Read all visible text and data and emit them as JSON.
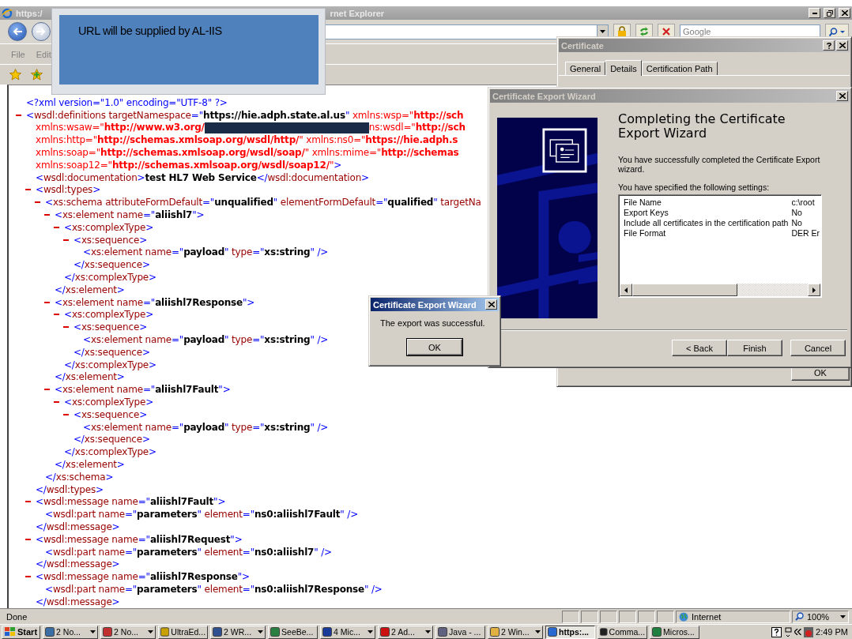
{
  "browser": {
    "title_left": "https:/",
    "title_right": "rnet Explorer",
    "search_placeholder": "Google",
    "menu": [
      "File",
      "Edit"
    ],
    "status": "Done",
    "zone": "Internet",
    "zoom": "100%"
  },
  "xml": [
    {
      "line": [
        {
          "kind": "punct",
          "text": "<?xml version=\"1.0\" encoding=\"UTF-8\" ?>"
        }
      ]
    },
    {
      "expanded": true,
      "open": [
        [
          {
            "kind": "punct",
            "text": "<"
          },
          {
            "kind": "name",
            "text": "wsdl:definitions targetNamespace"
          },
          {
            "kind": "punct",
            "text": "=\""
          },
          {
            "kind": "value",
            "text": "https://hie.adph.state.al.us"
          },
          {
            "kind": "punct",
            "text": "\""
          },
          {
            "kind": "ns_name",
            "text": " xmlns:wsp=\""
          },
          {
            "kind": "ns_value",
            "text": "http://sch"
          }
        ],
        [
          {
            "kind": "ns_name",
            "text": "xmlns:wsaw=\""
          },
          {
            "kind": "ns_value",
            "text": "http://www.w3.org/"
          },
          {
            "kind": "redaction"
          },
          {
            "kind": "ns_name",
            "text": "ns:wsdl=\""
          },
          {
            "kind": "ns_value",
            "text": "http://sch"
          }
        ],
        [
          {
            "kind": "ns_name",
            "text": "xmlns:http=\""
          },
          {
            "kind": "ns_value",
            "text": "http://schemas.xmlsoap.org/wsdl/http/"
          },
          {
            "kind": "ns_name",
            "text": "\" xmlns:ns0=\""
          },
          {
            "kind": "ns_value",
            "text": "https://hie.adph.s"
          }
        ],
        [
          {
            "kind": "ns_name",
            "text": "xmlns:soap=\""
          },
          {
            "kind": "ns_value",
            "text": "http://schemas.xmlsoap.org/wsdl/soap/"
          },
          {
            "kind": "ns_name",
            "text": "\" xmlns:mime=\""
          },
          {
            "kind": "ns_value",
            "text": "http://schemas"
          }
        ],
        [
          {
            "kind": "ns_name",
            "text": "xmlns:soap12=\""
          },
          {
            "kind": "ns_value",
            "text": "http://schemas.xmlsoap.org/wsdl/soap12/"
          },
          {
            "kind": "ns_name",
            "text": "\""
          },
          {
            "kind": "punct",
            "text": ">"
          }
        ]
      ],
      "children": [
        {
          "line": [
            {
              "kind": "punct",
              "text": "<"
            },
            {
              "kind": "name",
              "text": "wsdl:documentation"
            },
            {
              "kind": "punct",
              "text": ">"
            },
            {
              "kind": "text",
              "text": "test HL7 Web Service"
            },
            {
              "kind": "punct",
              "text": "</"
            },
            {
              "kind": "name",
              "text": "wsdl:documentation"
            },
            {
              "kind": "punct",
              "text": ">"
            }
          ]
        },
        {
          "expanded": true,
          "open": [
            [
              {
                "kind": "punct",
                "text": "<"
              },
              {
                "kind": "name",
                "text": "wsdl:types"
              },
              {
                "kind": "punct",
                "text": ">"
              }
            ]
          ],
          "children": [
            {
              "expanded": true,
              "open": [
                [
                  {
                    "kind": "punct",
                    "text": "<"
                  },
                  {
                    "kind": "name",
                    "text": "xs:schema attributeFormDefault"
                  },
                  {
                    "kind": "punct",
                    "text": "=\""
                  },
                  {
                    "kind": "value",
                    "text": "unqualified"
                  },
                  {
                    "kind": "punct",
                    "text": "\""
                  },
                  {
                    "kind": "name",
                    "text": " elementFormDefault"
                  },
                  {
                    "kind": "punct",
                    "text": "=\""
                  },
                  {
                    "kind": "value",
                    "text": "qualified"
                  },
                  {
                    "kind": "punct",
                    "text": "\""
                  },
                  {
                    "kind": "name",
                    "text": " targetNa"
                  }
                ]
              ],
              "children": [
                {
                  "expanded": true,
                  "open": [
                    [
                      {
                        "kind": "punct",
                        "text": "<"
                      },
                      {
                        "kind": "name",
                        "text": "xs:element name"
                      },
                      {
                        "kind": "punct",
                        "text": "=\""
                      },
                      {
                        "kind": "value",
                        "text": "aliishl7"
                      },
                      {
                        "kind": "punct",
                        "text": "\">"
                      }
                    ]
                  ],
                  "children": [
                    {
                      "expanded": true,
                      "open": [
                        [
                          {
                            "kind": "punct",
                            "text": "<"
                          },
                          {
                            "kind": "name",
                            "text": "xs:complexType"
                          },
                          {
                            "kind": "punct",
                            "text": ">"
                          }
                        ]
                      ],
                      "children": [
                        {
                          "expanded": true,
                          "open": [
                            [
                              {
                                "kind": "punct",
                                "text": "<"
                              },
                              {
                                "kind": "name",
                                "text": "xs:sequence"
                              },
                              {
                                "kind": "punct",
                                "text": ">"
                              }
                            ]
                          ],
                          "children": [
                            {
                              "line": [
                                {
                                  "kind": "punct",
                                  "text": "<"
                                },
                                {
                                  "kind": "name",
                                  "text": "xs:element name"
                                },
                                {
                                  "kind": "punct",
                                  "text": "=\""
                                },
                                {
                                  "kind": "value",
                                  "text": "payload"
                                },
                                {
                                  "kind": "punct",
                                  "text": "\""
                                },
                                {
                                  "kind": "name",
                                  "text": " type"
                                },
                                {
                                  "kind": "punct",
                                  "text": "=\""
                                },
                                {
                                  "kind": "value",
                                  "text": "xs:string"
                                },
                                {
                                  "kind": "punct",
                                  "text": "\" />"
                                }
                              ]
                            }
                          ],
                          "close": [
                            {
                              "kind": "punct",
                              "text": "</"
                            },
                            {
                              "kind": "name",
                              "text": "xs:sequence"
                            },
                            {
                              "kind": "punct",
                              "text": ">"
                            }
                          ]
                        }
                      ],
                      "close": [
                        {
                          "kind": "punct",
                          "text": "</"
                        },
                        {
                          "kind": "name",
                          "text": "xs:complexType"
                        },
                        {
                          "kind": "punct",
                          "text": ">"
                        }
                      ]
                    }
                  ],
                  "close": [
                    {
                      "kind": "punct",
                      "text": "</"
                    },
                    {
                      "kind": "name",
                      "text": "xs:element"
                    },
                    {
                      "kind": "punct",
                      "text": ">"
                    }
                  ]
                },
                {
                  "expanded": true,
                  "open": [
                    [
                      {
                        "kind": "punct",
                        "text": "<"
                      },
                      {
                        "kind": "name",
                        "text": "xs:element name"
                      },
                      {
                        "kind": "punct",
                        "text": "=\""
                      },
                      {
                        "kind": "value",
                        "text": "aliishl7Response"
                      },
                      {
                        "kind": "punct",
                        "text": "\">"
                      }
                    ]
                  ],
                  "children": [
                    {
                      "expanded": true,
                      "open": [
                        [
                          {
                            "kind": "punct",
                            "text": "<"
                          },
                          {
                            "kind": "name",
                            "text": "xs:complexType"
                          },
                          {
                            "kind": "punct",
                            "text": ">"
                          }
                        ]
                      ],
                      "children": [
                        {
                          "expanded": true,
                          "open": [
                            [
                              {
                                "kind": "punct",
                                "text": "<"
                              },
                              {
                                "kind": "name",
                                "text": "xs:sequence"
                              },
                              {
                                "kind": "punct",
                                "text": ">"
                              }
                            ]
                          ],
                          "children": [
                            {
                              "line": [
                                {
                                  "kind": "punct",
                                  "text": "<"
                                },
                                {
                                  "kind": "name",
                                  "text": "xs:element name"
                                },
                                {
                                  "kind": "punct",
                                  "text": "=\""
                                },
                                {
                                  "kind": "value",
                                  "text": "payload"
                                },
                                {
                                  "kind": "punct",
                                  "text": "\""
                                },
                                {
                                  "kind": "name",
                                  "text": " type"
                                },
                                {
                                  "kind": "punct",
                                  "text": "=\""
                                },
                                {
                                  "kind": "value",
                                  "text": "xs:string"
                                },
                                {
                                  "kind": "punct",
                                  "text": "\" />"
                                }
                              ]
                            }
                          ],
                          "close": [
                            {
                              "kind": "punct",
                              "text": "</"
                            },
                            {
                              "kind": "name",
                              "text": "xs:sequence"
                            },
                            {
                              "kind": "punct",
                              "text": ">"
                            }
                          ]
                        }
                      ],
                      "close": [
                        {
                          "kind": "punct",
                          "text": "</"
                        },
                        {
                          "kind": "name",
                          "text": "xs:complexType"
                        },
                        {
                          "kind": "punct",
                          "text": ">"
                        }
                      ]
                    }
                  ],
                  "close": [
                    {
                      "kind": "punct",
                      "text": "</"
                    },
                    {
                      "kind": "name",
                      "text": "xs:element"
                    },
                    {
                      "kind": "punct",
                      "text": ">"
                    }
                  ]
                },
                {
                  "expanded": true,
                  "open": [
                    [
                      {
                        "kind": "punct",
                        "text": "<"
                      },
                      {
                        "kind": "name",
                        "text": "xs:element name"
                      },
                      {
                        "kind": "punct",
                        "text": "=\""
                      },
                      {
                        "kind": "value",
                        "text": "aliishl7Fault"
                      },
                      {
                        "kind": "punct",
                        "text": "\">"
                      }
                    ]
                  ],
                  "children": [
                    {
                      "expanded": true,
                      "open": [
                        [
                          {
                            "kind": "punct",
                            "text": "<"
                          },
                          {
                            "kind": "name",
                            "text": "xs:complexType"
                          },
                          {
                            "kind": "punct",
                            "text": ">"
                          }
                        ]
                      ],
                      "children": [
                        {
                          "expanded": true,
                          "open": [
                            [
                              {
                                "kind": "punct",
                                "text": "<"
                              },
                              {
                                "kind": "name",
                                "text": "xs:sequence"
                              },
                              {
                                "kind": "punct",
                                "text": ">"
                              }
                            ]
                          ],
                          "children": [
                            {
                              "line": [
                                {
                                  "kind": "punct",
                                  "text": "<"
                                },
                                {
                                  "kind": "name",
                                  "text": "xs:element name"
                                },
                                {
                                  "kind": "punct",
                                  "text": "=\""
                                },
                                {
                                  "kind": "value",
                                  "text": "payload"
                                },
                                {
                                  "kind": "punct",
                                  "text": "\""
                                },
                                {
                                  "kind": "name",
                                  "text": " type"
                                },
                                {
                                  "kind": "punct",
                                  "text": "=\""
                                },
                                {
                                  "kind": "value",
                                  "text": "xs:string"
                                },
                                {
                                  "kind": "punct",
                                  "text": "\" />"
                                }
                              ]
                            }
                          ],
                          "close": [
                            {
                              "kind": "punct",
                              "text": "</"
                            },
                            {
                              "kind": "name",
                              "text": "xs:sequence"
                            },
                            {
                              "kind": "punct",
                              "text": ">"
                            }
                          ]
                        }
                      ],
                      "close": [
                        {
                          "kind": "punct",
                          "text": "</"
                        },
                        {
                          "kind": "name",
                          "text": "xs:complexType"
                        },
                        {
                          "kind": "punct",
                          "text": ">"
                        }
                      ]
                    }
                  ],
                  "close": [
                    {
                      "kind": "punct",
                      "text": "</"
                    },
                    {
                      "kind": "name",
                      "text": "xs:element"
                    },
                    {
                      "kind": "punct",
                      "text": ">"
                    }
                  ]
                }
              ],
              "close": [
                {
                  "kind": "punct",
                  "text": "</"
                },
                {
                  "kind": "name",
                  "text": "xs:schema"
                },
                {
                  "kind": "punct",
                  "text": ">"
                }
              ]
            }
          ],
          "close": [
            {
              "kind": "punct",
              "text": "</"
            },
            {
              "kind": "name",
              "text": "wsdl:types"
            },
            {
              "kind": "punct",
              "text": ">"
            }
          ]
        },
        {
          "expanded": true,
          "open": [
            [
              {
                "kind": "punct",
                "text": "<"
              },
              {
                "kind": "name",
                "text": "wsdl:message name"
              },
              {
                "kind": "punct",
                "text": "=\""
              },
              {
                "kind": "value",
                "text": "aliishl7Fault"
              },
              {
                "kind": "punct",
                "text": "\">"
              }
            ]
          ],
          "children": [
            {
              "line": [
                {
                  "kind": "punct",
                  "text": "<"
                },
                {
                  "kind": "name",
                  "text": "wsdl:part name"
                },
                {
                  "kind": "punct",
                  "text": "=\""
                },
                {
                  "kind": "value",
                  "text": "parameters"
                },
                {
                  "kind": "punct",
                  "text": "\""
                },
                {
                  "kind": "name",
                  "text": " element"
                },
                {
                  "kind": "punct",
                  "text": "=\""
                },
                {
                  "kind": "value",
                  "text": "ns0:aliishl7Fault"
                },
                {
                  "kind": "punct",
                  "text": "\" />"
                }
              ]
            }
          ],
          "close": [
            {
              "kind": "punct",
              "text": "</"
            },
            {
              "kind": "name",
              "text": "wsdl:message"
            },
            {
              "kind": "punct",
              "text": ">"
            }
          ]
        },
        {
          "expanded": true,
          "open": [
            [
              {
                "kind": "punct",
                "text": "<"
              },
              {
                "kind": "name",
                "text": "wsdl:message name"
              },
              {
                "kind": "punct",
                "text": "=\""
              },
              {
                "kind": "value",
                "text": "aliishl7Request"
              },
              {
                "kind": "punct",
                "text": "\">"
              }
            ]
          ],
          "children": [
            {
              "line": [
                {
                  "kind": "punct",
                  "text": "<"
                },
                {
                  "kind": "name",
                  "text": "wsdl:part name"
                },
                {
                  "kind": "punct",
                  "text": "=\""
                },
                {
                  "kind": "value",
                  "text": "parameters"
                },
                {
                  "kind": "punct",
                  "text": "\""
                },
                {
                  "kind": "name",
                  "text": " element"
                },
                {
                  "kind": "punct",
                  "text": "=\""
                },
                {
                  "kind": "value",
                  "text": "ns0:aliishl7"
                },
                {
                  "kind": "punct",
                  "text": "\" />"
                }
              ]
            }
          ],
          "close": [
            {
              "kind": "punct",
              "text": "</"
            },
            {
              "kind": "name",
              "text": "wsdl:message"
            },
            {
              "kind": "punct",
              "text": ">"
            }
          ]
        },
        {
          "expanded": true,
          "open": [
            [
              {
                "kind": "punct",
                "text": "<"
              },
              {
                "kind": "name",
                "text": "wsdl:message name"
              },
              {
                "kind": "punct",
                "text": "=\""
              },
              {
                "kind": "value",
                "text": "aliishl7Response"
              },
              {
                "kind": "punct",
                "text": "\">"
              }
            ]
          ],
          "children": [
            {
              "line": [
                {
                  "kind": "punct",
                  "text": "<"
                },
                {
                  "kind": "name",
                  "text": "wsdl:part name"
                },
                {
                  "kind": "punct",
                  "text": "=\""
                },
                {
                  "kind": "value",
                  "text": "parameters"
                },
                {
                  "kind": "punct",
                  "text": "\""
                },
                {
                  "kind": "name",
                  "text": " element"
                },
                {
                  "kind": "punct",
                  "text": "=\""
                },
                {
                  "kind": "value",
                  "text": "ns0:aliishl7Response"
                },
                {
                  "kind": "punct",
                  "text": "\" />"
                }
              ]
            }
          ],
          "close": [
            {
              "kind": "punct",
              "text": "</"
            },
            {
              "kind": "name",
              "text": "wsdl:message"
            },
            {
              "kind": "punct",
              "text": ">"
            }
          ]
        }
      ]
    }
  ],
  "popup": {
    "text": "URL will be supplied by AL-IIS"
  },
  "certificate_dialog": {
    "title": "Certificate",
    "tabs": [
      {
        "label": "General",
        "selected": false
      },
      {
        "label": "Details",
        "selected": true
      },
      {
        "label": "Certification Path",
        "selected": false
      }
    ],
    "ok_button": "OK"
  },
  "wizard": {
    "title": "Certificate Export Wizard",
    "heading": "Completing the Certificate Export Wizard",
    "intro": "You have successfully completed the Certificate Export wizard.",
    "settings_label": "You have specified the following settings:",
    "settings": [
      {
        "name": "File Name",
        "value": "c:\\root"
      },
      {
        "name": "Export Keys",
        "value": "No"
      },
      {
        "name": "Include all certificates in the certification path",
        "value": "No"
      },
      {
        "name": "File Format",
        "value": "DER Er"
      }
    ],
    "buttons": [
      "< Back",
      "Finish",
      "Cancel"
    ]
  },
  "message_box": {
    "title": "Certificate Export Wizard",
    "message": "The export was successful.",
    "button": "OK"
  },
  "taskbar": {
    "start": "Start",
    "items": [
      {
        "label": "2 No...",
        "grouped": true,
        "selected": false
      },
      {
        "label": "2 No...",
        "grouped": true,
        "selected": false
      },
      {
        "label": "UltraEd...",
        "grouped": false,
        "selected": false
      },
      {
        "label": "2 WR...",
        "grouped": true,
        "selected": false
      },
      {
        "label": "SeeBe...",
        "grouped": false,
        "selected": false
      },
      {
        "label": "4 Mic...",
        "grouped": true,
        "selected": false
      },
      {
        "label": "2 Ad...",
        "grouped": true,
        "selected": false
      },
      {
        "label": "Java - ...",
        "grouped": false,
        "selected": false
      },
      {
        "label": "2 Win...",
        "grouped": true,
        "selected": false
      },
      {
        "label": "https:...",
        "grouped": false,
        "selected": true
      },
      {
        "label": "Comma...",
        "grouped": false,
        "selected": false
      },
      {
        "label": "Micros...",
        "grouped": false,
        "selected": false
      }
    ],
    "clock": "2:49 PM"
  }
}
